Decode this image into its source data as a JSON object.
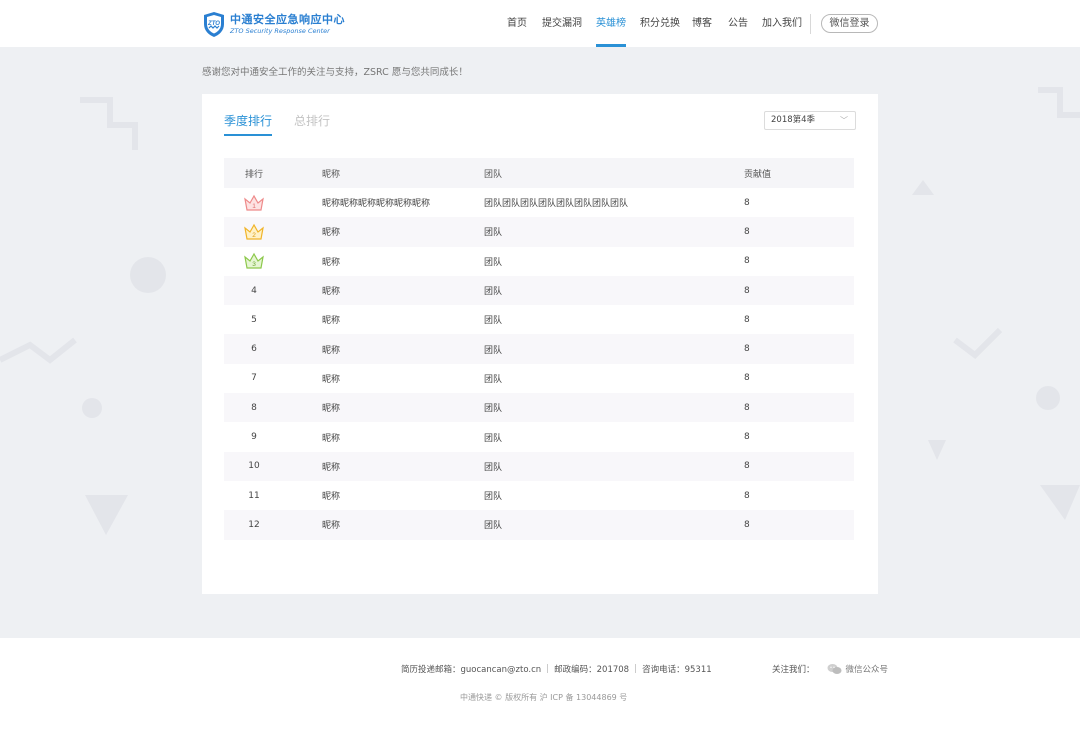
{
  "header": {
    "logo_badge": "ZTO",
    "logo_cn": "中通安全应急响应中心",
    "logo_en": "ZTO Security Response Center",
    "nav": [
      "首页",
      "提交漏洞",
      "英雄榜",
      "积分兑换",
      "博客",
      "公告",
      "加入我们"
    ],
    "active_nav": "英雄榜",
    "login_label": "微信登录"
  },
  "thanks": "感谢您对中通安全工作的关注与支持，ZSRC 愿与您共同成长！",
  "tabs": {
    "season": "季度排行",
    "total": "总排行"
  },
  "season_select": "2018第4季",
  "table": {
    "headers": {
      "rank": "排行",
      "nick": "昵称",
      "team": "团队",
      "score": "贡献值"
    },
    "rows": [
      {
        "rank": "1",
        "nick": "昵称昵称昵称昵称昵称昵称",
        "team": "团队团队团队团队团队团队团队团队",
        "score": "8"
      },
      {
        "rank": "2",
        "nick": "昵称",
        "team": "团队",
        "score": "8"
      },
      {
        "rank": "3",
        "nick": "昵称",
        "team": "团队",
        "score": "8"
      },
      {
        "rank": "4",
        "nick": "昵称",
        "team": "团队",
        "score": "8"
      },
      {
        "rank": "5",
        "nick": "昵称",
        "team": "团队",
        "score": "8"
      },
      {
        "rank": "6",
        "nick": "昵称",
        "team": "团队",
        "score": "8"
      },
      {
        "rank": "7",
        "nick": "昵称",
        "team": "团队",
        "score": "8"
      },
      {
        "rank": "8",
        "nick": "昵称",
        "team": "团队",
        "score": "8"
      },
      {
        "rank": "9",
        "nick": "昵称",
        "team": "团队",
        "score": "8"
      },
      {
        "rank": "10",
        "nick": "昵称",
        "team": "团队",
        "score": "8"
      },
      {
        "rank": "11",
        "nick": "昵称",
        "team": "团队",
        "score": "8"
      },
      {
        "rank": "12",
        "nick": "昵称",
        "team": "团队",
        "score": "8"
      }
    ]
  },
  "footer": {
    "email": "简历投递邮箱：guocancan@zto.cn",
    "postcode": "邮政编码：201708",
    "phone": "咨询电话：95311",
    "follow": "关注我们：",
    "wechat": "微信公众号",
    "copyright": "中通快递 © 版权所有 沪 ICP 备 13044869 号"
  },
  "colors": {
    "accent": "#2a91d6",
    "crown_gold": "#f0b429",
    "crown_silver": "#8cc84b",
    "crown_bronze": "#f08a8a"
  }
}
